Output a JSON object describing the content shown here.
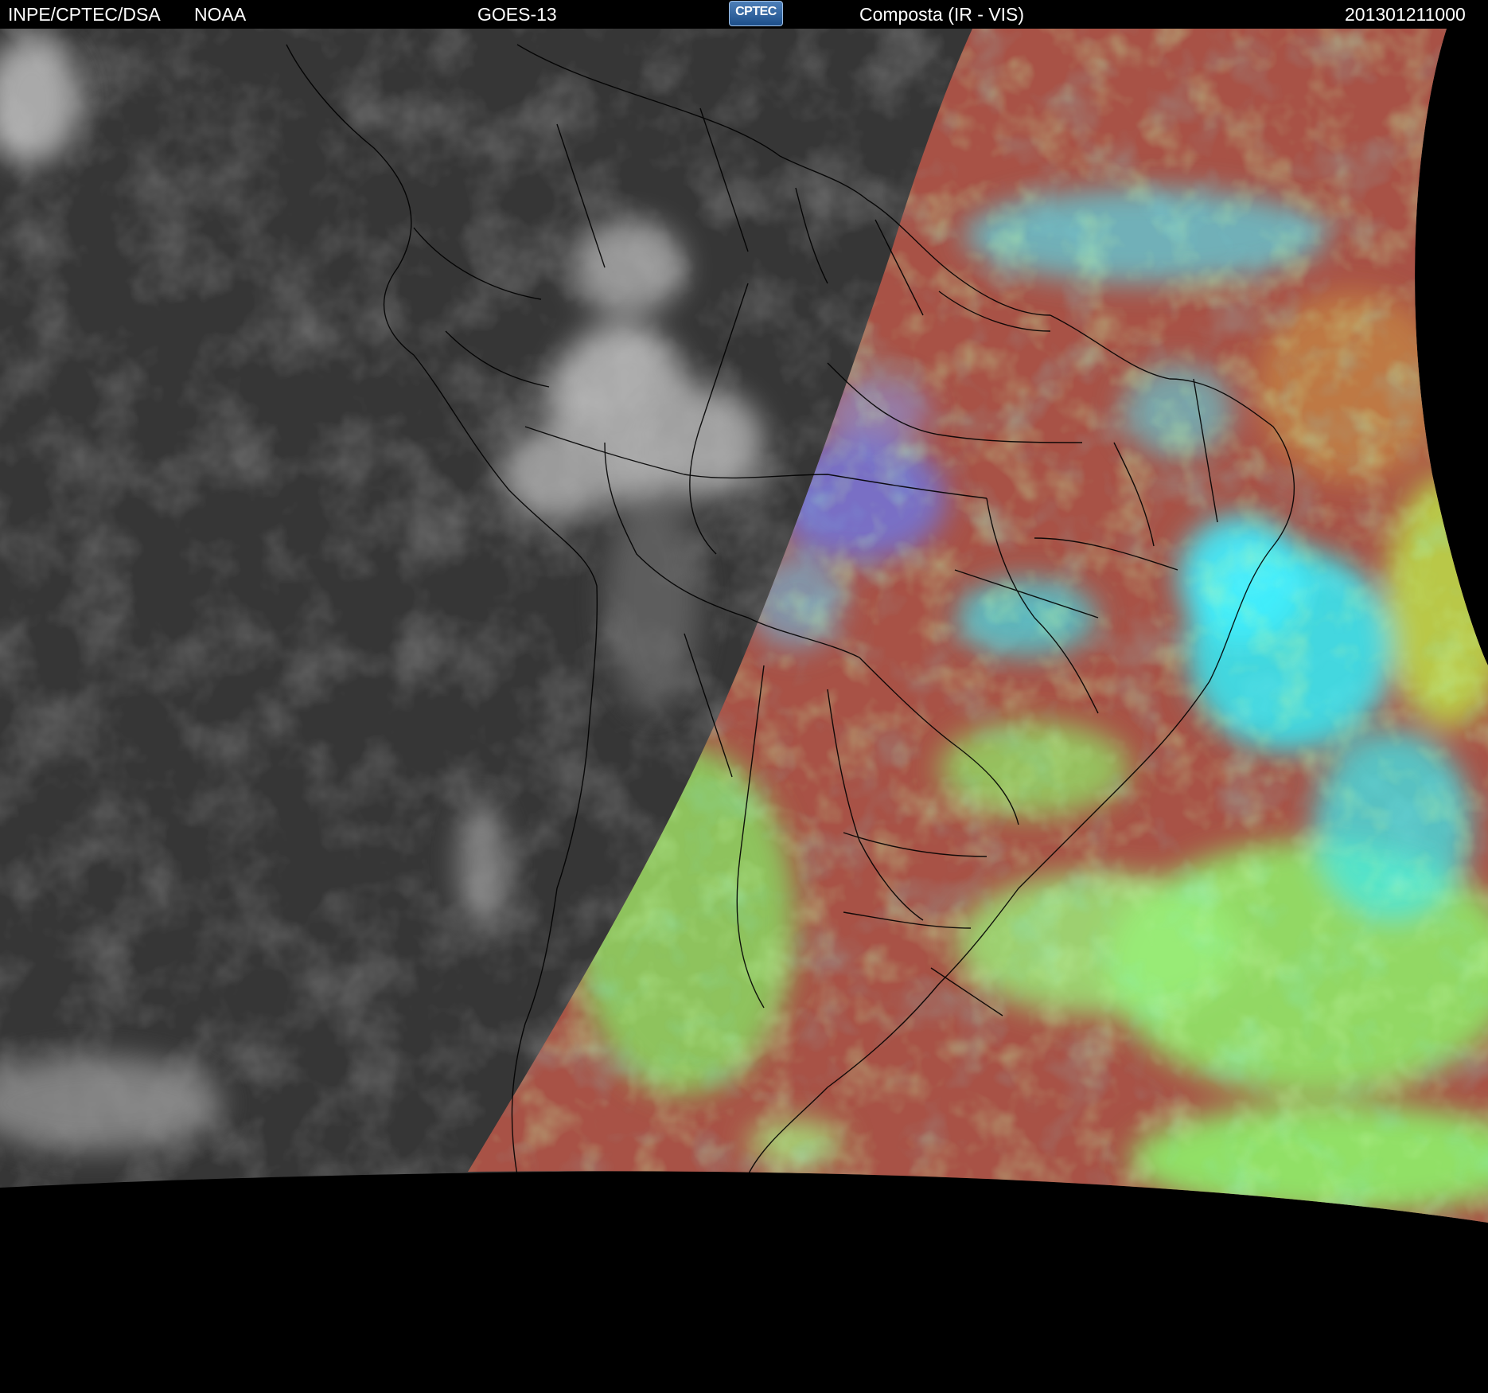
{
  "header": {
    "source": "INPE/CPTEC/DSA",
    "agency": "NOAA",
    "satellite": "GOES-13",
    "logo_text": "CPTEC",
    "product": "Composta (IR - VIS)",
    "timestamp": "201301211000"
  },
  "colors": {
    "header_bg": "#000000",
    "header_text": "#ffffff",
    "night_side": "#3a3a3a",
    "day_land_red": "#a34f48",
    "day_cloud_green": "#8ef06a",
    "day_cloud_cyan": "#38e6f0",
    "outer_space": "#000000"
  },
  "icons": {
    "logo": "cptec-logo-icon"
  }
}
